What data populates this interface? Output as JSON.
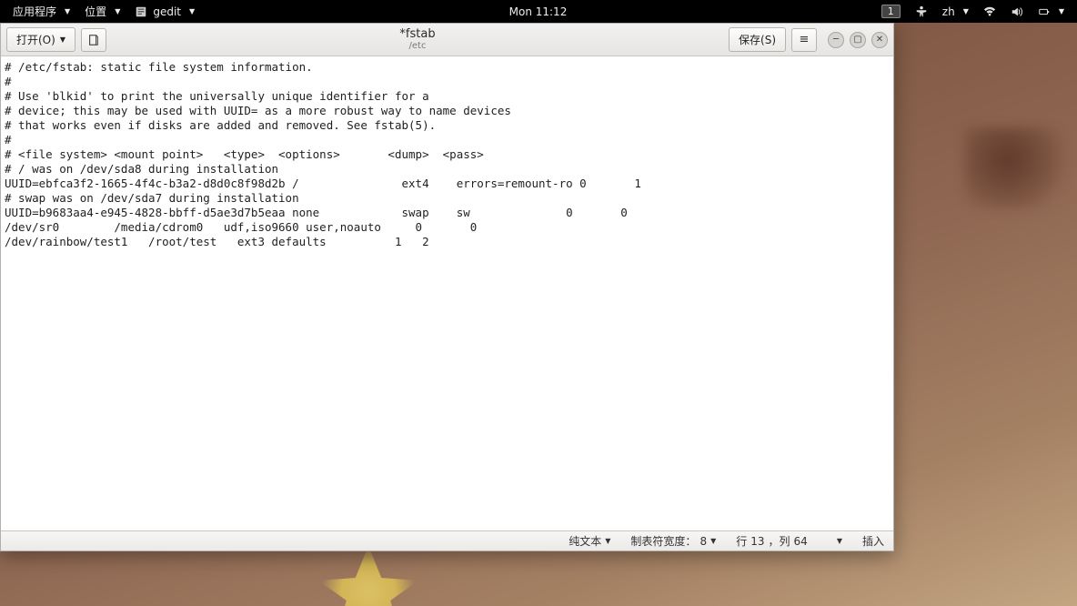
{
  "topbar": {
    "apps_label": "应用程序",
    "places_label": "位置",
    "active_app": "gedit",
    "clock": "Mon 11:12",
    "workspace": "1",
    "input_method": "zh"
  },
  "gedit": {
    "open_label": "打开(O)",
    "save_label": "保存(S)",
    "title": "*fstab",
    "subtitle": "/etc",
    "content": "# /etc/fstab: static file system information.\n#\n# Use 'blkid' to print the universally unique identifier for a\n# device; this may be used with UUID= as a more robust way to name devices\n# that works even if disks are added and removed. See fstab(5).\n#\n# <file system> <mount point>   <type>  <options>       <dump>  <pass>\n# / was on /dev/sda8 during installation\nUUID=ebfca3f2-1665-4f4c-b3a2-d8d0c8f98d2b /               ext4    errors=remount-ro 0       1\n# swap was on /dev/sda7 during installation\nUUID=b9683aa4-e945-4828-bbff-d5ae3d7b5eaa none            swap    sw              0       0\n/dev/sr0        /media/cdrom0   udf,iso9660 user,noauto     0       0\n/dev/rainbow/test1   /root/test   ext3 defaults          1   2",
    "status": {
      "syntax": "纯文本",
      "tab_width_label": "制表符宽度：",
      "tab_width_value": "8",
      "position_prefix": "行 ",
      "line": "13",
      "position_mid": "，列 ",
      "col": "64",
      "insert_mode": "插入"
    }
  }
}
